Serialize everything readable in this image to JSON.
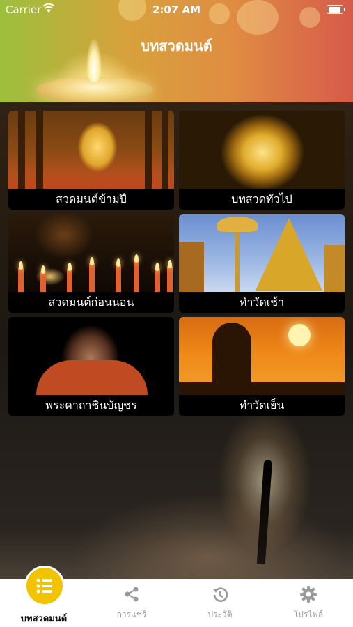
{
  "status": {
    "carrier": "Carrier",
    "time": "2:07 AM"
  },
  "header": {
    "title": "บทสวดมนต์"
  },
  "grid": [
    {
      "label": "สวดมนต์ข้ามปี"
    },
    {
      "label": "บทสวดทั่วไป"
    },
    {
      "label": "สวดมนต์ก่อนนอน"
    },
    {
      "label": "ทำวัดเช้า"
    },
    {
      "label": "พระคาถาชินบัญชร"
    },
    {
      "label": "ทำวัดเย็น"
    }
  ],
  "tabbar": {
    "items": [
      {
        "label": "บทสวดมนต์",
        "icon": "list-icon",
        "active": true
      },
      {
        "label": "การแชร์",
        "icon": "share-icon",
        "active": false
      },
      {
        "label": "ประวัติ",
        "icon": "history-icon",
        "active": false
      },
      {
        "label": "โปรไฟล์",
        "icon": "gear-icon",
        "active": false
      }
    ]
  },
  "colors": {
    "accent": "#f2c300",
    "tab_inactive": "#9a9a9a"
  }
}
